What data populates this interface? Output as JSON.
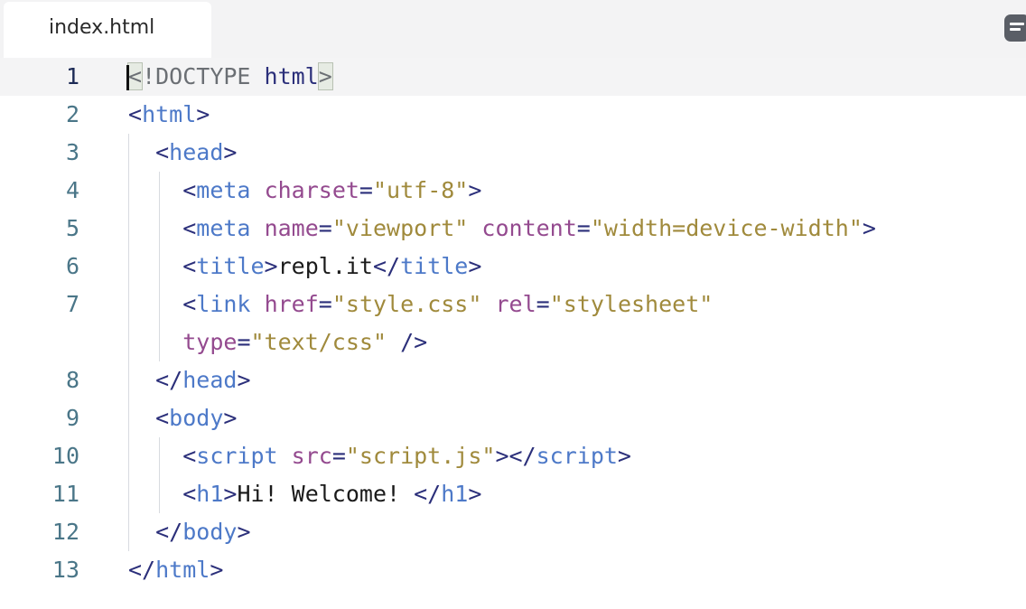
{
  "tab": {
    "label": "index.html"
  },
  "toolbar": {
    "menu_icon": "menu-icon"
  },
  "editor": {
    "active_line": 1,
    "line_numbers": [
      "1",
      "2",
      "3",
      "4",
      "5",
      "6",
      "7",
      "8",
      "9",
      "10",
      "11",
      "12",
      "13"
    ],
    "lines": [
      [
        {
          "t": "<",
          "c": "dt",
          "m": 1
        },
        {
          "t": "!DOCTYPE ",
          "c": "dt"
        },
        {
          "t": "html",
          "c": "tb"
        },
        {
          "t": ">",
          "c": "dt",
          "m": 1
        }
      ],
      [
        {
          "t": "<",
          "c": "tb"
        },
        {
          "t": "html",
          "c": "tn"
        },
        {
          "t": ">",
          "c": "tb"
        }
      ],
      [
        {
          "t": "  "
        },
        {
          "t": "<",
          "c": "tb"
        },
        {
          "t": "head",
          "c": "tn"
        },
        {
          "t": ">",
          "c": "tb"
        }
      ],
      [
        {
          "t": "    "
        },
        {
          "t": "<",
          "c": "tb"
        },
        {
          "t": "meta",
          "c": "tn"
        },
        {
          "t": " "
        },
        {
          "t": "charset",
          "c": "at"
        },
        {
          "t": "=",
          "c": "tb"
        },
        {
          "t": "\"utf-8\"",
          "c": "sv"
        },
        {
          "t": ">",
          "c": "tb"
        }
      ],
      [
        {
          "t": "    "
        },
        {
          "t": "<",
          "c": "tb"
        },
        {
          "t": "meta",
          "c": "tn"
        },
        {
          "t": " "
        },
        {
          "t": "name",
          "c": "at"
        },
        {
          "t": "=",
          "c": "tb"
        },
        {
          "t": "\"viewport\"",
          "c": "sv"
        },
        {
          "t": " "
        },
        {
          "t": "content",
          "c": "at"
        },
        {
          "t": "=",
          "c": "tb"
        },
        {
          "t": "\"width=device-width\"",
          "c": "sv"
        },
        {
          "t": ">",
          "c": "tb"
        }
      ],
      [
        {
          "t": "    "
        },
        {
          "t": "<",
          "c": "tb"
        },
        {
          "t": "title",
          "c": "tn"
        },
        {
          "t": ">",
          "c": "tb"
        },
        {
          "t": "repl.it",
          "c": "pl"
        },
        {
          "t": "</",
          "c": "tb"
        },
        {
          "t": "title",
          "c": "tn"
        },
        {
          "t": ">",
          "c": "tb"
        }
      ],
      [
        {
          "t": "    "
        },
        {
          "t": "<",
          "c": "tb"
        },
        {
          "t": "link",
          "c": "tn"
        },
        {
          "t": " "
        },
        {
          "t": "href",
          "c": "at"
        },
        {
          "t": "=",
          "c": "tb"
        },
        {
          "t": "\"style.css\"",
          "c": "sv"
        },
        {
          "t": " "
        },
        {
          "t": "rel",
          "c": "at"
        },
        {
          "t": "=",
          "c": "tb"
        },
        {
          "t": "\"stylesheet\"",
          "c": "sv"
        }
      ],
      [
        {
          "t": "    "
        },
        {
          "t": "type",
          "c": "at"
        },
        {
          "t": "=",
          "c": "tb"
        },
        {
          "t": "\"text/css\"",
          "c": "sv"
        },
        {
          "t": " "
        },
        {
          "t": "/>",
          "c": "tb"
        }
      ],
      [
        {
          "t": "  "
        },
        {
          "t": "</",
          "c": "tb"
        },
        {
          "t": "head",
          "c": "tn"
        },
        {
          "t": ">",
          "c": "tb"
        }
      ],
      [
        {
          "t": "  "
        },
        {
          "t": "<",
          "c": "tb"
        },
        {
          "t": "body",
          "c": "tn"
        },
        {
          "t": ">",
          "c": "tb"
        }
      ],
      [
        {
          "t": "    "
        },
        {
          "t": "<",
          "c": "tb"
        },
        {
          "t": "script",
          "c": "tn"
        },
        {
          "t": " "
        },
        {
          "t": "src",
          "c": "at"
        },
        {
          "t": "=",
          "c": "tb"
        },
        {
          "t": "\"script.js\"",
          "c": "sv"
        },
        {
          "t": "></",
          "c": "tb"
        },
        {
          "t": "script",
          "c": "tn"
        },
        {
          "t": ">",
          "c": "tb"
        }
      ],
      [
        {
          "t": "    "
        },
        {
          "t": "<",
          "c": "tb"
        },
        {
          "t": "h1",
          "c": "tn"
        },
        {
          "t": ">",
          "c": "tb"
        },
        {
          "t": "Hi! Welcome! ",
          "c": "pl"
        },
        {
          "t": "</",
          "c": "tb"
        },
        {
          "t": "h1",
          "c": "tn"
        },
        {
          "t": ">",
          "c": "tb"
        }
      ],
      [
        {
          "t": "  "
        },
        {
          "t": "</",
          "c": "tb"
        },
        {
          "t": "body",
          "c": "tn"
        },
        {
          "t": ">",
          "c": "tb"
        }
      ],
      [
        {
          "t": "</",
          "c": "tb"
        },
        {
          "t": "html",
          "c": "tn"
        },
        {
          "t": ">",
          "c": "tb"
        }
      ]
    ]
  }
}
